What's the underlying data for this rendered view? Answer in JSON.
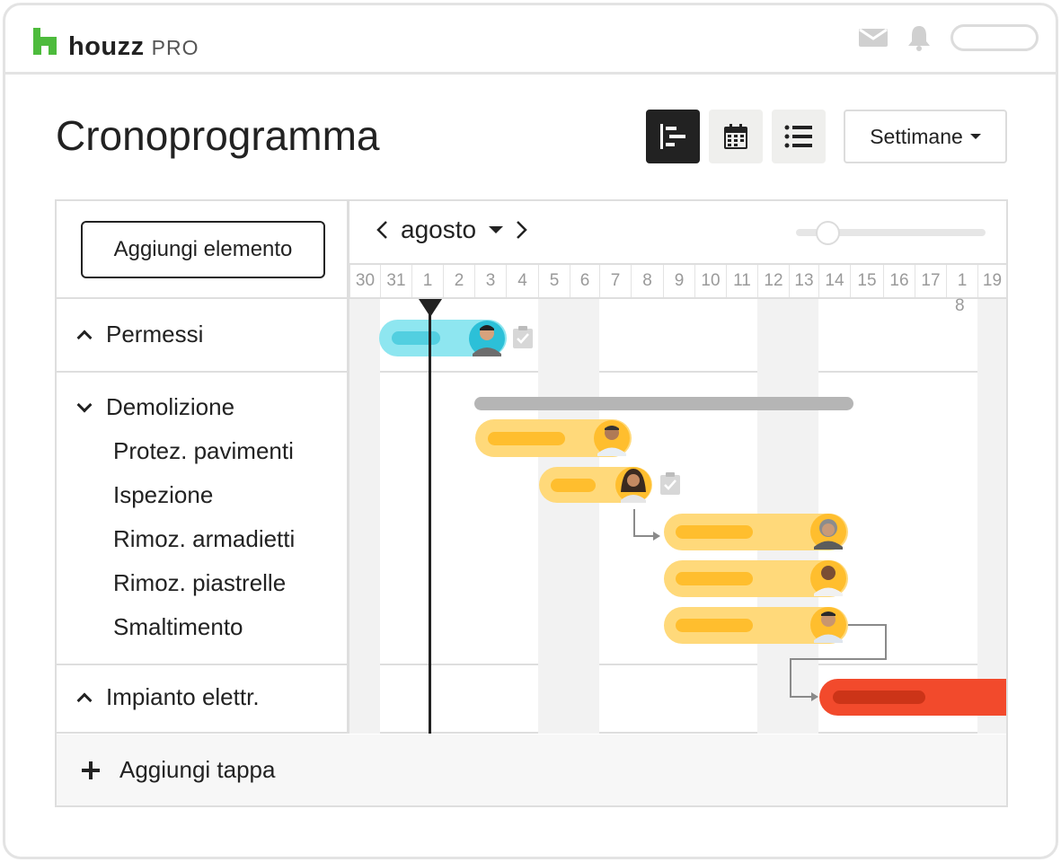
{
  "brand": {
    "name": "houzz",
    "suffix": "PRO"
  },
  "top_icons": [
    "mail-icon",
    "bell-icon"
  ],
  "page_title": "Cronoprogramma",
  "view_buttons": [
    "gantt-view-icon",
    "calendar-view-icon",
    "list-view-icon"
  ],
  "active_view": "gantt-view-icon",
  "range_select": {
    "label": "Settimane"
  },
  "toolbar": {
    "add_item_label": "Aggiungi elemento",
    "add_milestone_label": "Aggiungi tappa"
  },
  "timeline": {
    "month": "agosto",
    "days": [
      "30",
      "31",
      "1",
      "2",
      "3",
      "4",
      "5",
      "6",
      "7",
      "8",
      "9",
      "10",
      "11",
      "12",
      "13",
      "14",
      "15",
      "16",
      "17",
      "1",
      "19"
    ],
    "day_18_second_line": "8",
    "today_day": "1"
  },
  "groups": [
    {
      "name": "Permessi",
      "expanded": false,
      "tasks": []
    },
    {
      "name": "Demolizione",
      "expanded": true,
      "tasks": [
        "Protez. pavimenti",
        "Ispezione",
        "Rimoz. armadietti",
        "Rimoz. piastrelle",
        "Smaltimento"
      ]
    },
    {
      "name": "Impianto elettr.",
      "expanded": false,
      "tasks": []
    }
  ],
  "colors": {
    "permit": "#8ee6f0",
    "demolition": "#ffd97a",
    "demolition_inner": "#ffbe2e",
    "electrical": "#f24a2c",
    "summary": "#b5b5b5"
  }
}
